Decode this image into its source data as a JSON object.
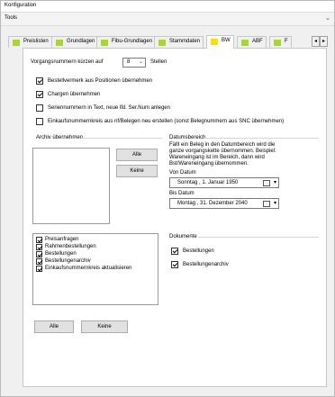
{
  "window": {
    "title": "Konfiguration"
  },
  "menubar": {
    "label": "Tools"
  },
  "tabs": [
    {
      "label": "Preislisten"
    },
    {
      "label": "Grundlagen"
    },
    {
      "label": "Fibu-Grundlagen"
    },
    {
      "label": "Stammdaten"
    },
    {
      "label": "BW"
    },
    {
      "label": "ABF"
    },
    {
      "label": "F"
    }
  ],
  "tab_arrows": {
    "left": "◂",
    "right": "▸"
  },
  "bw": {
    "vorgangsnummer_label": "Vorgangsnummern kürzen auf",
    "vorgangsnummer_value": "8",
    "stellen_label": "Stellen",
    "options": [
      {
        "label": "Bestellvermerk aus Positionen übernehmen",
        "checked": true
      },
      {
        "label": "Chargen übernehmen",
        "checked": true
      },
      {
        "label": "Seriennummern in Text, neue lfd. Ser.Num anlegen",
        "checked": false
      },
      {
        "label": "Einkaufsnummernkreis aus nf/Belegen neu erstellen (sonst Belegnummern aus SNC übernehmen)",
        "checked": false
      }
    ],
    "archiv": {
      "title": "Archiv übernehmen",
      "btn_alle": "Alle",
      "btn_keine": "Keine"
    },
    "datumsbereich": {
      "title": "Datumsbereich",
      "note": "Fällt ein Beleg in den Datumbereich wird die ganze vorgangskette übernommen. Beispiel: Wareneingang ist im Bereich, dann wird Bst/Wareneingang übernommen.",
      "von_label": "Von Datum",
      "von_value": "Sonntag  ,  1.  Januar  1950",
      "bis_label": "Bis Datum",
      "bis_value": "Montag  , 31. Dezember 2040"
    },
    "list2_items": [
      {
        "label": "Preisanfragen",
        "checked": true
      },
      {
        "label": "Rahmenbestellungen",
        "checked": true
      },
      {
        "label": "Bestellungen",
        "checked": true
      },
      {
        "label": "Bestellungenarchiv",
        "checked": true
      },
      {
        "label": "Einkaufsnummernkreis aktualisieren",
        "checked": true
      }
    ],
    "dokumente": {
      "title": "Dokumente",
      "items": [
        {
          "label": "Bestellungen",
          "checked": true
        },
        {
          "label": "Bestellungenarchiv",
          "checked": true
        }
      ]
    },
    "bottom_btn_alle": "Alle",
    "bottom_btn_keine": "Keine"
  }
}
